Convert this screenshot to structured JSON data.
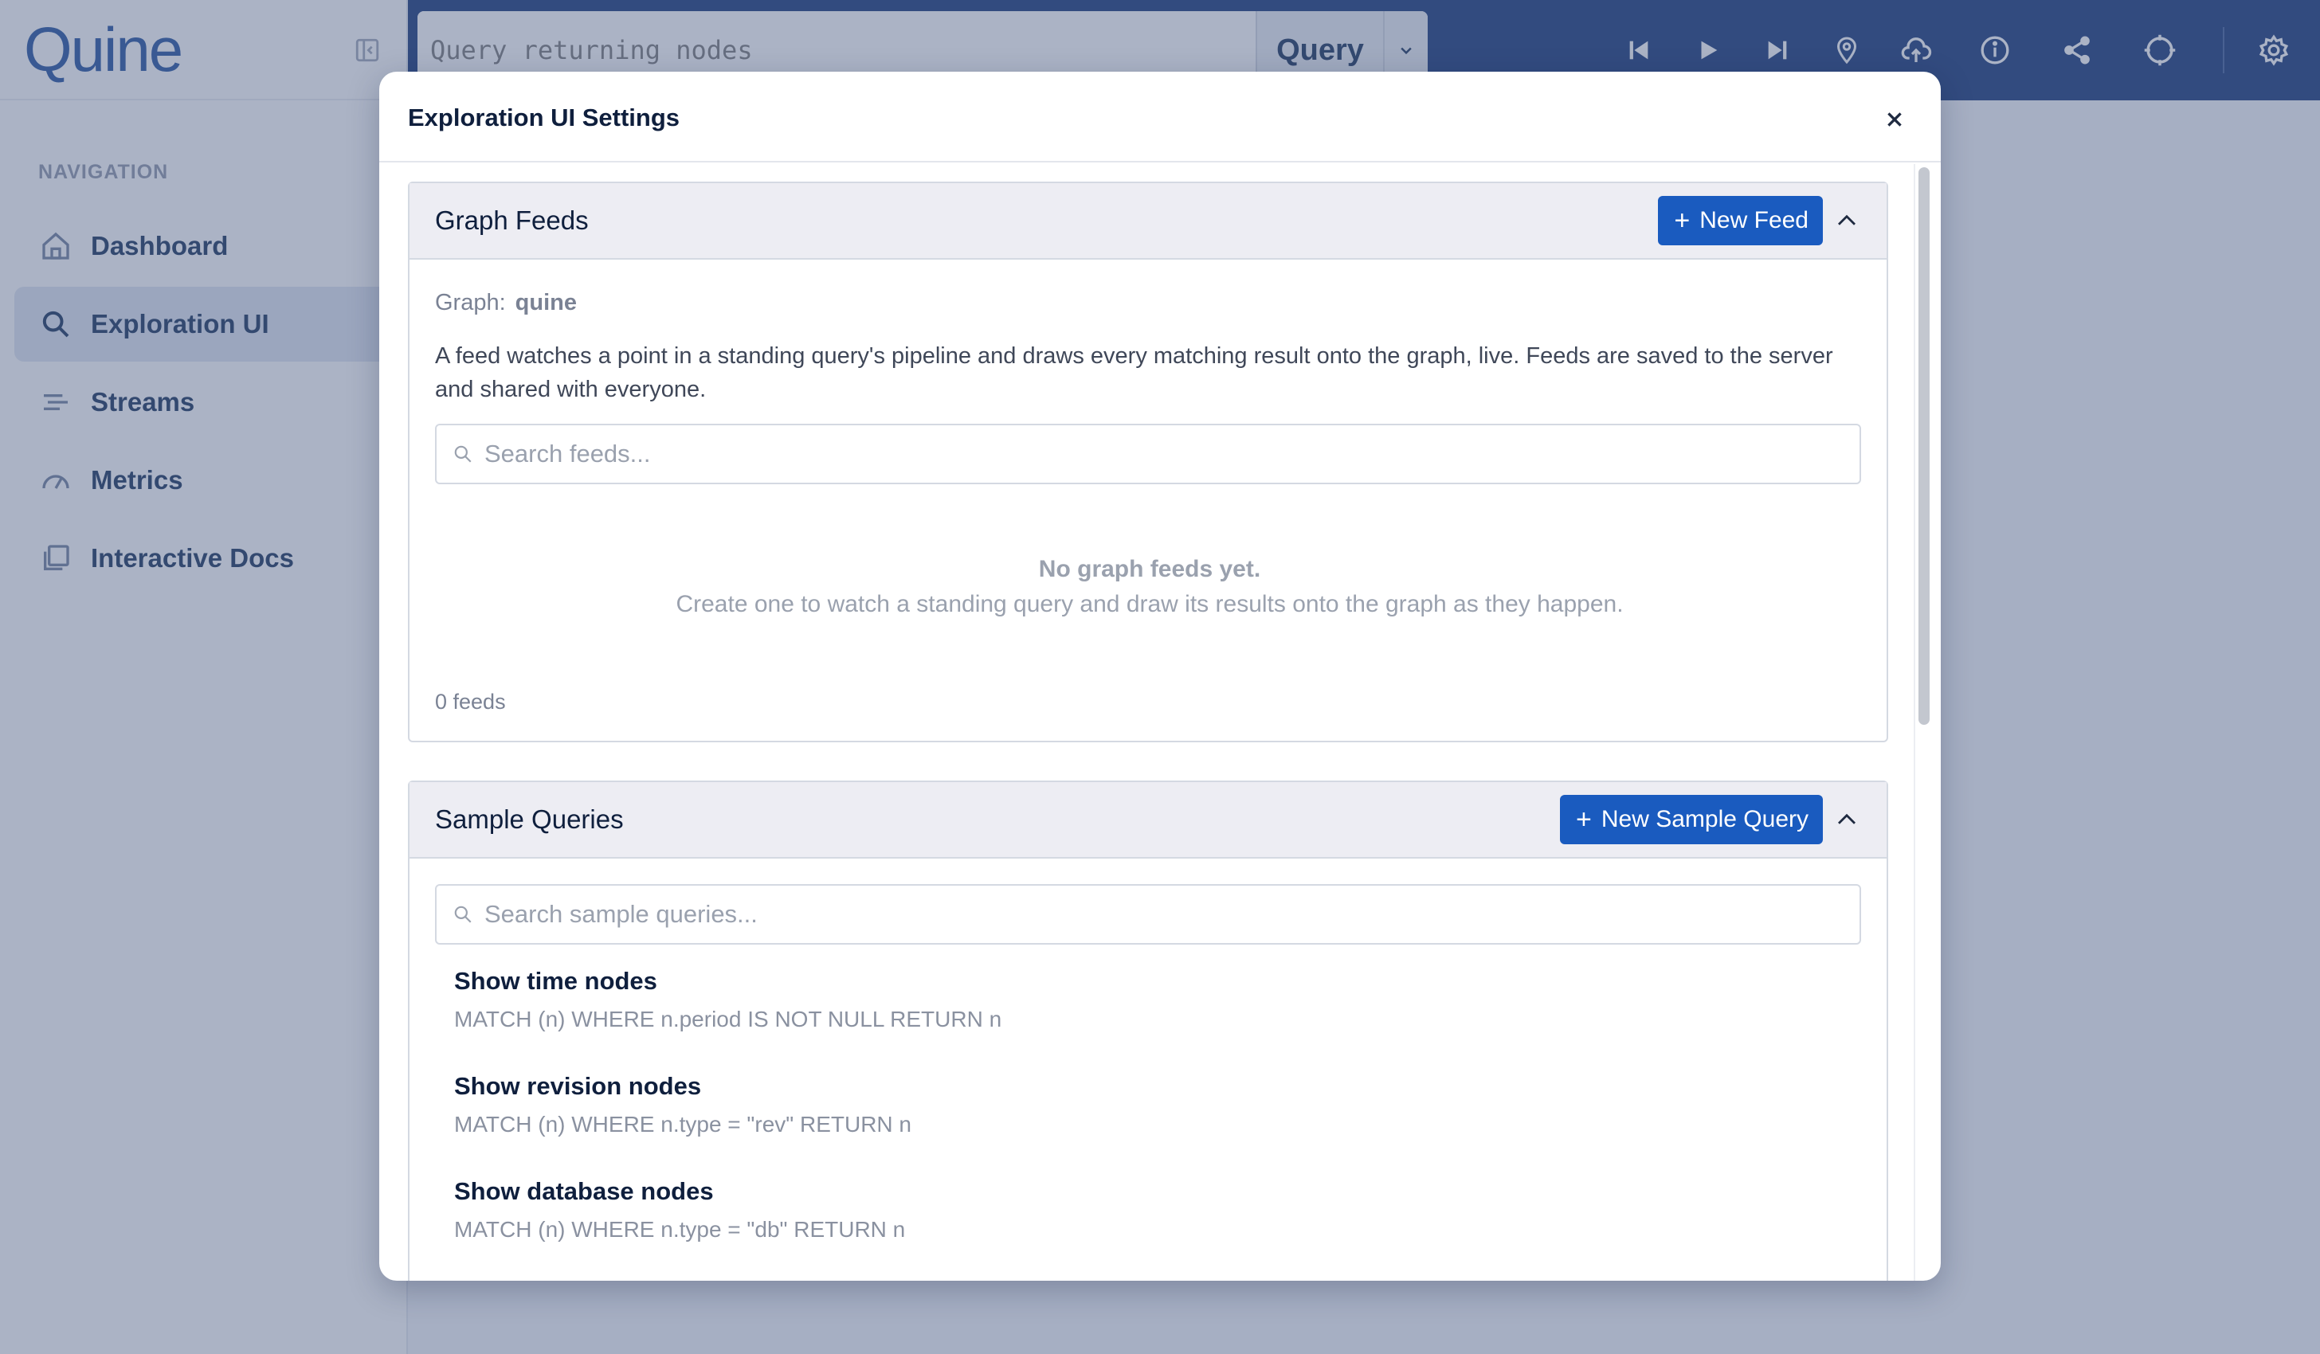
{
  "app": {
    "logo": "Quine",
    "nav_heading": "NAVIGATION",
    "nav_items": [
      {
        "label": "Dashboard",
        "icon": "home-icon"
      },
      {
        "label": "Exploration UI",
        "icon": "search-icon",
        "active": true
      },
      {
        "label": "Streams",
        "icon": "streams-icon"
      },
      {
        "label": "Metrics",
        "icon": "gauge-icon"
      },
      {
        "label": "Interactive Docs",
        "icon": "docs-icon"
      }
    ],
    "query_placeholder": "Query returning nodes",
    "query_button": "Query",
    "toolbar_icons": [
      "skip-back-icon",
      "play-icon",
      "skip-forward-icon",
      "location-pin-icon",
      "cloud-upload-icon",
      "info-icon",
      "share-icon",
      "crosshair-icon",
      "gear-icon"
    ]
  },
  "modal": {
    "title": "Exploration UI Settings",
    "graph_feeds": {
      "title": "Graph Feeds",
      "new_button": "New Feed",
      "graph_label": "Graph:",
      "graph_name": "quine",
      "description": "A feed watches a point in a standing query's pipeline and draws every matching result onto the graph, live. Feeds are saved to the server and shared with everyone.",
      "search_placeholder": "Search feeds...",
      "empty_title": "No graph feeds yet.",
      "empty_subtitle": "Create one to watch a standing query and draw its results onto the graph as they happen.",
      "count": "0 feeds"
    },
    "sample_queries": {
      "title": "Sample Queries",
      "new_button": "New Sample Query",
      "search_placeholder": "Search sample queries...",
      "items": [
        {
          "name": "Show time nodes",
          "query": "MATCH (n) WHERE n.period IS NOT NULL RETURN n"
        },
        {
          "name": "Show revision nodes",
          "query": "MATCH (n) WHERE n.type = \"rev\" RETURN n"
        },
        {
          "name": "Show database nodes",
          "query": "MATCH (n) WHERE n.type = \"db\" RETURN n"
        }
      ]
    }
  },
  "colors": {
    "topbar": "#0d2f73",
    "primary": "#1a5bbf",
    "overlay": "rgba(88,104,140,0.5)"
  }
}
